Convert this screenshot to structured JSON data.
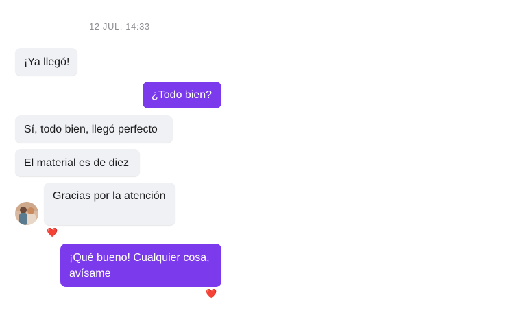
{
  "timestamp": "12 JUL, 14:33",
  "messages": [
    {
      "text": "¡Ya llegó!"
    },
    {
      "text": "¿Todo bien?"
    },
    {
      "text": "Sí, todo bien, llegó perfecto"
    },
    {
      "text": "El material es de diez"
    },
    {
      "text": "Gracias por la atención",
      "reaction": "❤️"
    },
    {
      "text": "¡Qué bueno! Cualquier cosa, avísame",
      "reaction": "❤️"
    }
  ],
  "colors": {
    "outgoing_bubble": "#7c3aed",
    "incoming_bubble": "#f0f1f4",
    "timestamp_text": "#8e8e93"
  },
  "icons": {
    "reaction": "red-heart",
    "avatar": "contact-photo"
  }
}
